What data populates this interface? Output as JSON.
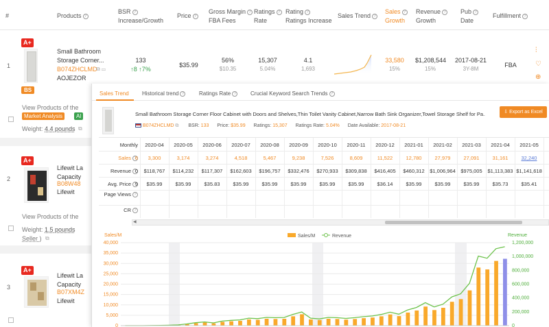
{
  "header": {
    "hash": "#",
    "products": "Products",
    "bsr_line1": "BSR",
    "bsr_line2": "Increase/Growth",
    "price": "Price",
    "gm_line1": "Gross Margin",
    "gm_line2": "FBA Fees",
    "ratings_line1": "Ratings",
    "ratings_line2": "Rate",
    "rating_line1": "Rating",
    "rating_line2": "Ratings Increase",
    "sales_trend": "Sales Trend",
    "sales_line1": "Sales",
    "sales_line2": "Growth",
    "revenue_line1": "Revenue",
    "revenue_line2": "Growth",
    "pub_line1": "Pub",
    "pub_line2": "Date",
    "fulfillment": "Fulfillment"
  },
  "products": [
    {
      "index": "1",
      "badge": "A+",
      "bs": "BS",
      "title1": "Small Bathroom",
      "title2": "Storage Corner...",
      "asin": "B074ZHCLMD",
      "brand": "AOJEZOR",
      "bsr": "133",
      "bsr_change": "↑8  ↑7%",
      "price": "$35.99",
      "gm": "56%",
      "fba": "$10.35",
      "ratings": "15,307",
      "rate": "5.04%",
      "rating": "4.1",
      "ratings_increase": "1,693",
      "sales": "33,580",
      "sales_growth": "15%",
      "revenue": "$1,208,544",
      "revenue_growth": "15%",
      "pub_date": "2017-08-21",
      "pub_age": "3Y-8M",
      "fulfillment": "FBA",
      "view_text": "View Products of the",
      "tag1": "Market Analysis",
      "tag2": "Al",
      "weight_label": "Weight:",
      "weight": "4.4 pounds"
    },
    {
      "index": "2",
      "badge": "A+",
      "title1": "Lifewit La",
      "title2": "Capacity",
      "asin": "B08W48",
      "brand": "Lifewit",
      "view_text": "View Products of the",
      "weight_label": "Weight:",
      "weight": "1.5 pounds",
      "seller": "Seller )"
    },
    {
      "index": "3",
      "badge": "A+",
      "title1": "Lifewit La",
      "title2": "Capacity",
      "asin": "B07XM4Z",
      "brand": "Lifewit"
    }
  ],
  "panel": {
    "tabs": [
      "Sales Trend",
      "Historical trend",
      "Ratings Rate",
      "Crucial Keyword Search Trends"
    ],
    "product_title": "Small Bathroom Storage Corner Floor Cabinet with Doors and Shelves,Thin Toilet Vanity Cabinet,Narrow Bath Sink Organizer,Towel Storage Shelf for Pa...",
    "asin": "B074ZHCLMD",
    "bsr_label": "BSR:",
    "bsr": "133",
    "price_label": "Price:",
    "price": "$35.99",
    "ratings_label": "Ratings:",
    "ratings": "15,307",
    "rate_label": "Ratings Rate:",
    "rate": "5.04%",
    "date_label": "Date Available:",
    "date": "2017-08-21",
    "export": "Export as Excel",
    "table": {
      "first_header": "Monthly",
      "months": [
        "2020-04",
        "2020-05",
        "2020-06",
        "2020-07",
        "2020-08",
        "2020-09",
        "2020-10",
        "2020-11",
        "2020-12",
        "2021-01",
        "2021-02",
        "2021-03",
        "2021-04",
        "2021-05"
      ],
      "rows": [
        {
          "label": "Sales",
          "lead": "6",
          "values": [
            "3,300",
            "3,174",
            "3,274",
            "4,518",
            "5,467",
            "9,238",
            "7,526",
            "8,609",
            "11,522",
            "12,780",
            "27,979",
            "27,091",
            "31,161",
            "32,240"
          ]
        },
        {
          "label": "Revenue",
          "lead": "0",
          "values": [
            "$118,767",
            "$114,232",
            "$117,307",
            "$162,603",
            "$196,757",
            "$332,476",
            "$270,933",
            "$309,838",
            "$416,405",
            "$460,312",
            "$1,006,964",
            "$975,005",
            "$1,113,383",
            "$1,141,618"
          ]
        },
        {
          "label": "Avg. Price",
          "lead": "9",
          "values": [
            "$35.99",
            "$35.99",
            "$35.83",
            "$35.99",
            "$35.99",
            "$35.99",
            "$35.99",
            "$35.99",
            "$36.14",
            "$35.99",
            "$35.99",
            "$35.99",
            "$35.73",
            "$35.41"
          ]
        },
        {
          "label": "Page Views",
          "lead": "",
          "values": []
        },
        {
          "label": "CR",
          "lead": "",
          "values": []
        }
      ]
    }
  },
  "chart_data": {
    "type": "bar",
    "ylabel": "Sales/M",
    "y2label": "Revenue",
    "legend": [
      "Sales/M",
      "Revenue"
    ],
    "legend_position": "top-center",
    "ylim": [
      0,
      40000
    ],
    "y2lim": [
      0,
      1200000
    ],
    "yticks": [
      "40,000",
      "35,000",
      "30,000",
      "25,000",
      "20,000",
      "15,000",
      "10,000",
      "5,000",
      "0"
    ],
    "y2ticks": [
      "1,200,000",
      "1,000,000",
      "800,000",
      "600,000",
      "400,000",
      "200,000",
      "0"
    ],
    "series": [
      {
        "name": "Sales/M",
        "values": [
          0,
          0,
          0,
          50,
          80,
          150,
          300,
          700,
          1200,
          1500,
          1100,
          1800,
          2100,
          2300,
          3000,
          2800,
          3300,
          3200,
          3300,
          4500,
          5500,
          3000,
          2700,
          3300,
          3200,
          2900,
          3200,
          3600,
          3900,
          4500,
          5400,
          4600,
          6300,
          7300,
          9200,
          7500,
          8600,
          11500,
          12800,
          17000,
          28000,
          27100,
          31200,
          32240
        ]
      },
      {
        "name": "Revenue",
        "values": [
          0,
          0,
          0,
          2000,
          3000,
          6000,
          11000,
          25000,
          43000,
          54000,
          40000,
          65000,
          76000,
          83000,
          108000,
          101000,
          119000,
          115000,
          118000,
          163000,
          197000,
          108000,
          97000,
          119000,
          115000,
          104000,
          115000,
          130000,
          140000,
          162000,
          194000,
          166000,
          227000,
          263000,
          332000,
          271000,
          310000,
          416000,
          460000,
          612000,
          1007000,
          975000,
          1113000,
          1141618
        ]
      }
    ],
    "colors": {
      "bar": "#f9a92b",
      "last_bar": "#8e8fe8",
      "line": "#6cc24a"
    }
  }
}
